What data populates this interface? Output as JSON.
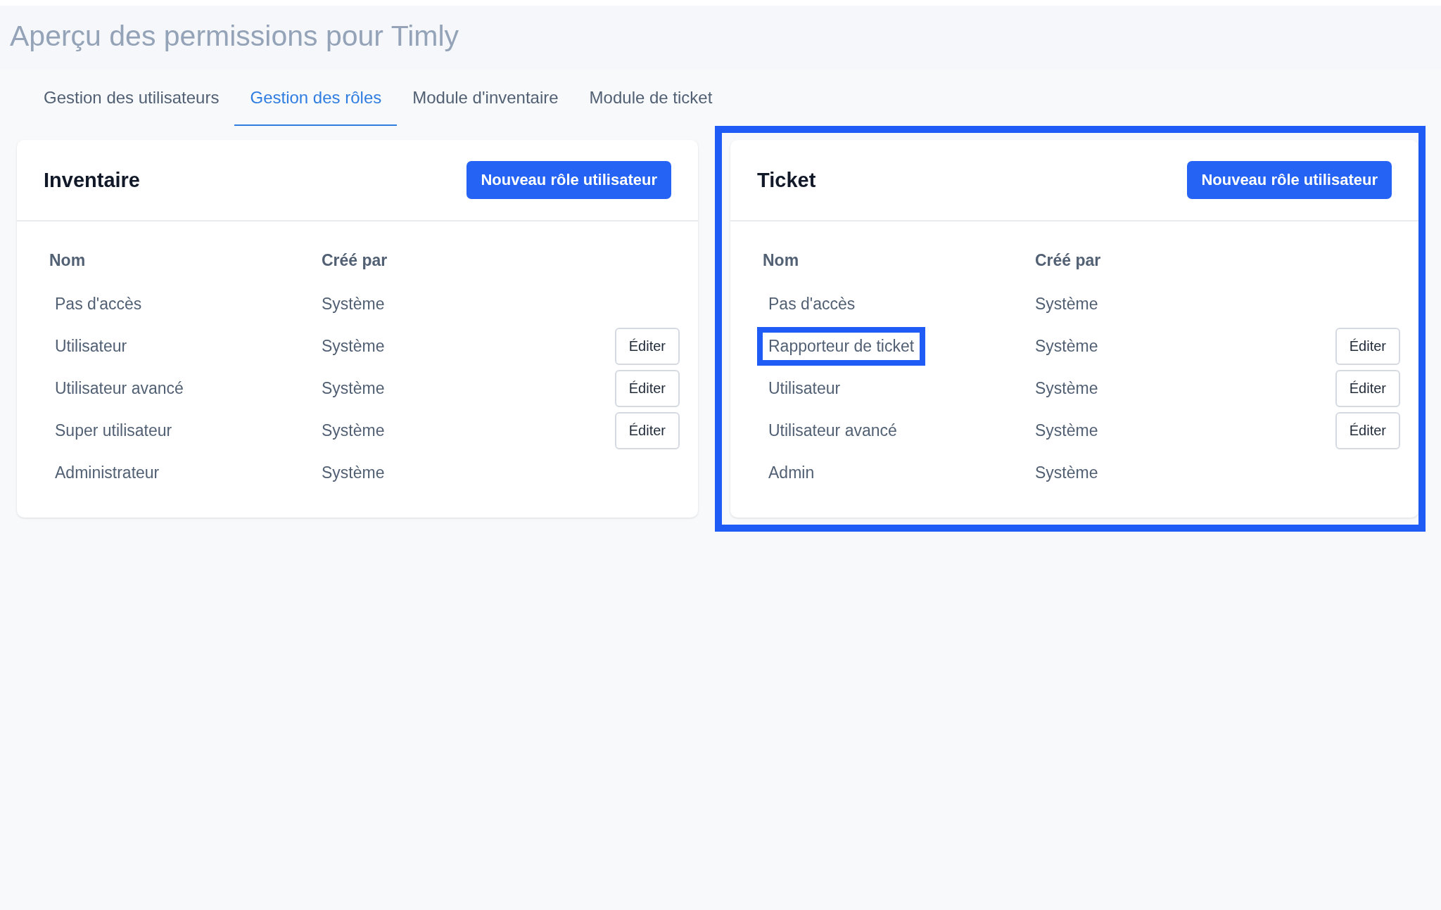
{
  "page_title": "Aperçu des permissions pour Timly",
  "tabs": [
    {
      "label": "Gestion des utilisateurs",
      "selected": false
    },
    {
      "label": "Gestion des rôles",
      "selected": true
    },
    {
      "label": "Module d'inventaire",
      "selected": false
    },
    {
      "label": "Module de ticket",
      "selected": false
    }
  ],
  "panels": [
    {
      "title": "Inventaire",
      "highlighted": false,
      "button": "Nouveau rôle utilisateur",
      "columns": [
        "Nom",
        "Créé par"
      ],
      "rows": [
        {
          "name": "Pas d'accès",
          "created_by": "Système",
          "highlighted": false
        },
        {
          "name": "Utilisateur",
          "created_by": "Système",
          "action": "Éditer",
          "highlighted": false
        },
        {
          "name": "Utilisateur avancé",
          "created_by": "Système",
          "action": "Éditer",
          "highlighted": false
        },
        {
          "name": "Super utilisateur",
          "created_by": "Système",
          "action": "Éditer",
          "highlighted": false
        },
        {
          "name": "Administrateur",
          "created_by": "Système",
          "highlighted": false
        }
      ]
    },
    {
      "title": "Ticket",
      "highlighted": true,
      "button": "Nouveau rôle utilisateur",
      "columns": [
        "Nom",
        "Créé par"
      ],
      "rows": [
        {
          "name": "Pas d'accès",
          "created_by": "Système",
          "highlighted": false
        },
        {
          "name": "Rapporteur de ticket",
          "created_by": "Système",
          "action": "Éditer",
          "highlighted": true
        },
        {
          "name": "Utilisateur",
          "created_by": "Système",
          "action": "Éditer",
          "highlighted": false
        },
        {
          "name": "Utilisateur avancé",
          "created_by": "Système",
          "action": "Éditer",
          "highlighted": false
        },
        {
          "name": "Admin",
          "created_by": "Système",
          "highlighted": false
        }
      ]
    }
  ]
}
